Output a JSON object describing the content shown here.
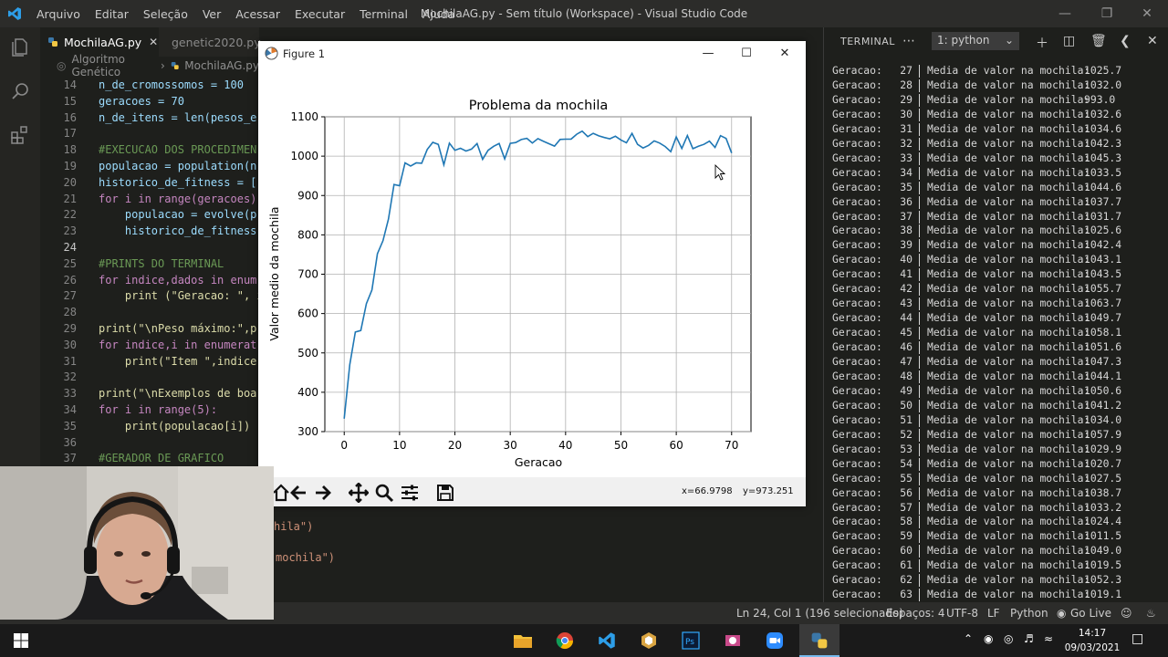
{
  "window": {
    "title": "MochilaAG.py - Sem título (Workspace) - Visual Studio Code",
    "menu": [
      "Arquivo",
      "Editar",
      "Seleção",
      "Ver",
      "Acessar",
      "Executar",
      "Terminal",
      "Ajuda"
    ]
  },
  "editor": {
    "tabs": [
      {
        "label": "MochilaAG.py",
        "active": true
      },
      {
        "label": "genetic2020.py",
        "active": false
      }
    ],
    "breadcrumb": [
      "Algoritmo Genético",
      "MochilaAG.py"
    ],
    "lines": [
      {
        "n": "14",
        "text": "n_de_cromossomos = 100"
      },
      {
        "n": "15",
        "text": "geracoes = 70"
      },
      {
        "n": "16",
        "text": "n_de_itens = len(pesos_e"
      },
      {
        "n": "17",
        "text": ""
      },
      {
        "n": "18",
        "text": "#EXECUCAO DOS PROCEDIMEN"
      },
      {
        "n": "19",
        "text": "populacao = population(n"
      },
      {
        "n": "20",
        "text": "historico_de_fitness = ["
      },
      {
        "n": "21",
        "text": "for i in range(geracoes)"
      },
      {
        "n": "22",
        "text": "    populacao = evolve(p"
      },
      {
        "n": "23",
        "text": "    historico_de_fitness"
      },
      {
        "n": "24",
        "text": ""
      },
      {
        "n": "25",
        "text": "#PRINTS DO TERMINAL"
      },
      {
        "n": "26",
        "text": "for indice,dados in enum"
      },
      {
        "n": "27",
        "text": "    print (\"Geracao: \", i"
      },
      {
        "n": "28",
        "text": ""
      },
      {
        "n": "29",
        "text": "print(\"\\nPeso máximo:\",p"
      },
      {
        "n": "30",
        "text": "for indice,i in enumerat"
      },
      {
        "n": "31",
        "text": "    print(\"Item \",indice"
      },
      {
        "n": "32",
        "text": ""
      },
      {
        "n": "33",
        "text": "print(\"\\nExemplos de boa"
      },
      {
        "n": "34",
        "text": "for i in range(5):"
      },
      {
        "n": "35",
        "text": "    print(populacao[i])"
      },
      {
        "n": "36",
        "text": ""
      },
      {
        "n": "37",
        "text": "#GERADOR DE GRAFICO"
      }
    ],
    "hidden_fragments": [
      "hila\")",
      "mochila\")"
    ]
  },
  "terminal": {
    "label": "TERMINAL",
    "shell": "1: python",
    "row_label": "Geracao:",
    "row_mid": "Media de valor na mochila:",
    "rows": [
      [
        "27",
        "1025.7"
      ],
      [
        "28",
        "1032.0"
      ],
      [
        "29",
        "993.0"
      ],
      [
        "30",
        "1032.6"
      ],
      [
        "31",
        "1034.6"
      ],
      [
        "32",
        "1042.3"
      ],
      [
        "33",
        "1045.3"
      ],
      [
        "34",
        "1033.5"
      ],
      [
        "35",
        "1044.6"
      ],
      [
        "36",
        "1037.7"
      ],
      [
        "37",
        "1031.7"
      ],
      [
        "38",
        "1025.6"
      ],
      [
        "39",
        "1042.4"
      ],
      [
        "40",
        "1043.1"
      ],
      [
        "41",
        "1043.5"
      ],
      [
        "42",
        "1055.7"
      ],
      [
        "43",
        "1063.7"
      ],
      [
        "44",
        "1049.7"
      ],
      [
        "45",
        "1058.1"
      ],
      [
        "46",
        "1051.6"
      ],
      [
        "47",
        "1047.3"
      ],
      [
        "48",
        "1044.1"
      ],
      [
        "49",
        "1050.6"
      ],
      [
        "50",
        "1041.2"
      ],
      [
        "51",
        "1034.0"
      ],
      [
        "52",
        "1057.9"
      ],
      [
        "53",
        "1029.9"
      ],
      [
        "54",
        "1020.7"
      ],
      [
        "55",
        "1027.5"
      ],
      [
        "56",
        "1038.7"
      ],
      [
        "57",
        "1033.2"
      ],
      [
        "58",
        "1024.4"
      ],
      [
        "59",
        "1011.5"
      ],
      [
        "60",
        "1049.0"
      ],
      [
        "61",
        "1019.5"
      ],
      [
        "62",
        "1052.3"
      ],
      [
        "63",
        "1019.1"
      ]
    ]
  },
  "status": {
    "position": "Ln 24, Col 1 (196 selecionado)",
    "spaces": "Espaços: 4",
    "encoding": "UTF-8",
    "eol": "LF",
    "language": "Python",
    "golive": "Go Live"
  },
  "taskbar": {
    "time": "14:17",
    "date": "09/03/2021"
  },
  "figure": {
    "title": "Figure 1",
    "coords_x": "x=66.9798",
    "coords_y": "y=973.251"
  },
  "colors": {
    "line": "#1f77b4",
    "editor_bg": "#1e1f1c",
    "titlebar": "#2c2c2a"
  },
  "chart_data": {
    "type": "line",
    "title": "Problema da mochila",
    "xlabel": "Geracao",
    "ylabel": "Valor medio da mochila",
    "xlim": [
      -3.5,
      73.5
    ],
    "ylim": [
      300,
      1100
    ],
    "xticks": [
      0,
      10,
      20,
      30,
      40,
      50,
      60,
      70
    ],
    "yticks": [
      300,
      400,
      500,
      600,
      700,
      800,
      900,
      1000,
      1100
    ],
    "grid": true,
    "series": [
      {
        "x": [
          0,
          1,
          2,
          3,
          4,
          5,
          6,
          7,
          8,
          9,
          10,
          11,
          12,
          13,
          14,
          15,
          16,
          17,
          18,
          19,
          20,
          21,
          22,
          23,
          24,
          25,
          26,
          27,
          28,
          29,
          30,
          31,
          32,
          33,
          34,
          35,
          36,
          37,
          38,
          39,
          40,
          41,
          42,
          43,
          44,
          45,
          46,
          47,
          48,
          49,
          50,
          51,
          52,
          53,
          54,
          55,
          56,
          57,
          58,
          59,
          60,
          61,
          62,
          63,
          64,
          65,
          66,
          67,
          68,
          69,
          70
        ],
        "y": [
          333,
          470,
          553,
          557,
          625,
          660,
          752,
          785,
          840,
          928,
          925,
          983,
          975,
          983,
          982,
          1017,
          1035,
          1030,
          978,
          1033,
          1015,
          1020,
          1013,
          1018,
          1032,
          992,
          1015,
          1025,
          1032,
          993,
          1032.6,
          1034.6,
          1042.3,
          1045.3,
          1033.5,
          1044.6,
          1037.7,
          1031.7,
          1025.6,
          1042.4,
          1043.1,
          1043.5,
          1055.7,
          1063.7,
          1049.7,
          1058.1,
          1051.6,
          1047.3,
          1044.1,
          1050.6,
          1041.2,
          1034.0,
          1057.9,
          1029.9,
          1020.7,
          1027.5,
          1038.7,
          1033.2,
          1024.4,
          1011.5,
          1049.0,
          1019.5,
          1052.3,
          1019.1,
          1025,
          1030,
          1038,
          1022,
          1052,
          1045,
          1008
        ]
      }
    ]
  }
}
